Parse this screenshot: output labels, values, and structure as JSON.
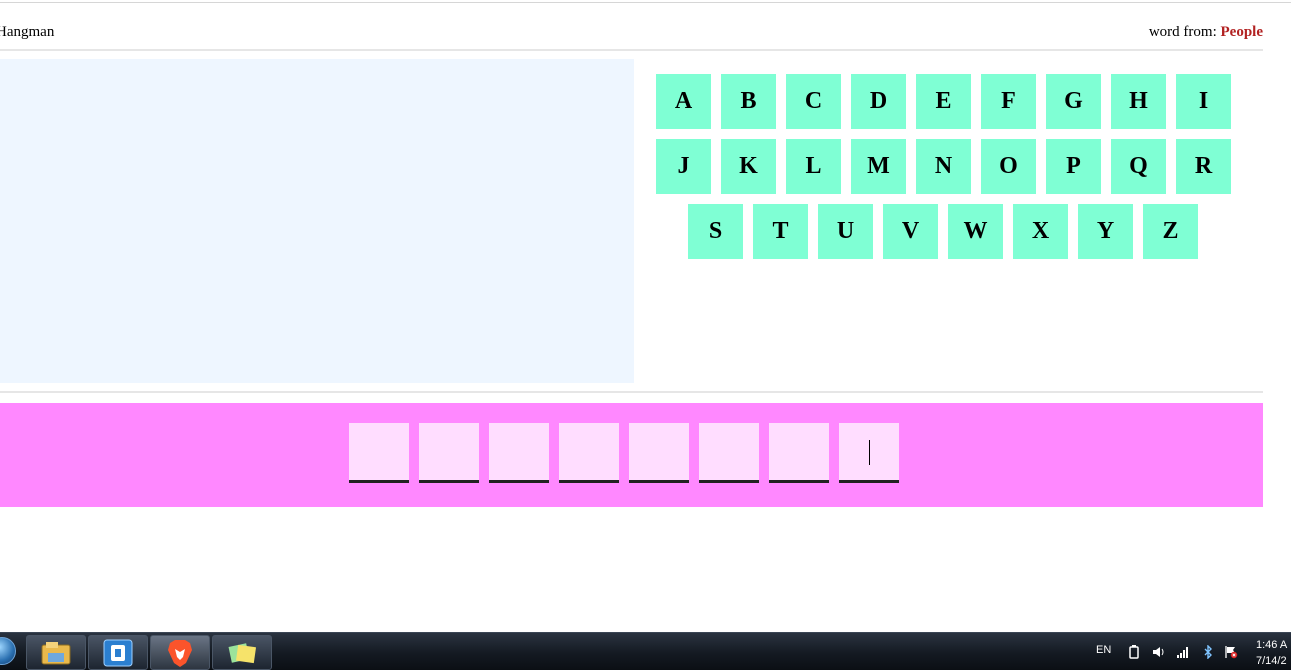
{
  "header": {
    "title": "Hangman",
    "word_from_label": "word from:",
    "category": "People"
  },
  "keyboard": {
    "rows": [
      [
        "A",
        "B",
        "C",
        "D",
        "E",
        "F",
        "G",
        "H",
        "I"
      ],
      [
        "J",
        "K",
        "L",
        "M",
        "N",
        "O",
        "P",
        "Q",
        "R"
      ],
      [
        "S",
        "T",
        "U",
        "V",
        "W",
        "X",
        "Y",
        "Z"
      ]
    ]
  },
  "word": {
    "slots": [
      "",
      "",
      "",
      "",
      "",
      "",
      "",
      ""
    ]
  },
  "taskbar": {
    "language": "EN",
    "time": "1:46 A",
    "date": "7/14/2",
    "apps": [
      "file-explorer-icon",
      "app-icon",
      "brave-browser-icon",
      "sticky-notes-icon"
    ]
  },
  "colors": {
    "key_bg": "#7fffd4",
    "word_area_bg": "#ff88ff",
    "slot_bg": "#ffddff",
    "gallows_bg": "#eef6ff",
    "category": "#b22222"
  }
}
